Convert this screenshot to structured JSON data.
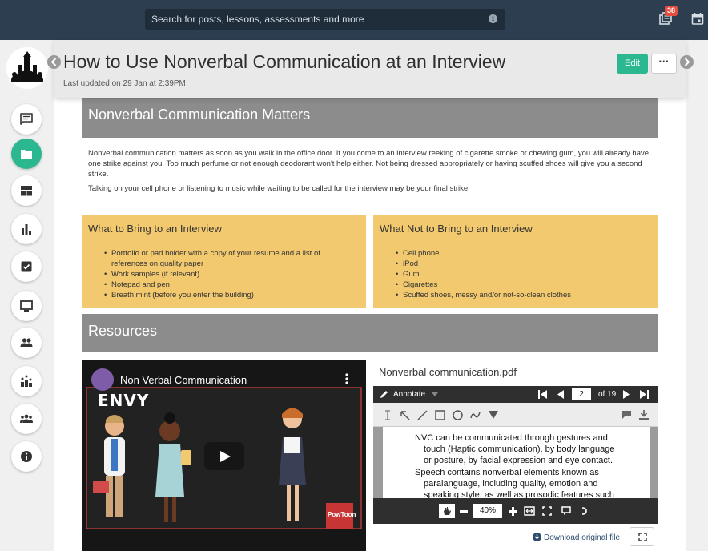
{
  "topbar": {
    "search_placeholder": "Search for posts, lessons, assessments and more",
    "notification_count": "38"
  },
  "header": {
    "title": "How to Use Nonverbal Communication at an Interview",
    "updated": "Last updated on 29 Jan at 2:39PM",
    "edit_label": "Edit",
    "more_label": "···"
  },
  "section1": {
    "title": "Nonverbal Communication Matters",
    "para1": "Nonverbal communication matters as soon as you walk in the office door. If you come to an interview reeking of cigarette smoke or chewing gum, you will already have one strike against you. Too much perfume or not enough deodorant won't help either. Not being dressed appropriately or having scuffed shoes will give you a second strike.",
    "para2": "Talking on your cell phone or listening to music while waiting to be called for the interview may be your final strike."
  },
  "bring": {
    "title": "What to Bring to an Interview",
    "items": [
      "Portfolio or pad holder with a copy of your resume and a list of",
      "references on quality paper",
      "Work samples (if relevant)",
      "Notepad and pen",
      "Breath mint (before you enter the building)"
    ]
  },
  "not_bring": {
    "title": "What Not to Bring to an Interview",
    "items": [
      "Cell phone",
      "iPod",
      "Gum",
      "Cigarettes",
      "Scuffed shoes, messy and/or not-so-clean clothes"
    ]
  },
  "resources": {
    "title": "Resources"
  },
  "video": {
    "title": "Non Verbal Communication",
    "overlay_word": "ENVY",
    "badge": "PowToon"
  },
  "pdf": {
    "filename": "Nonverbal communication.pdf",
    "annotate_label": "Annotate",
    "page_current": "2",
    "page_total": "of 19",
    "zoom": "40%",
    "lines": [
      "NVC can be communicated through gestures and",
      "touch (Haptic communication), by body language",
      "or posture, by facial expression and eye contact.",
      "Speech contains nonverbal elements known as",
      "paralanguage, including quality, emotion and",
      "speaking style, as well as prosodic features such"
    ],
    "download_label": "Download original file"
  },
  "colors": {
    "topbar": "#2c3e50",
    "accent": "#2bb890",
    "band": "#8c8c8c",
    "yellow": "#f2c96e",
    "badge": "#e74c3c"
  },
  "rail_icons": [
    "comments-icon",
    "folder-icon",
    "dashboard-icon",
    "bar-chart-icon",
    "checkbox-icon",
    "monitor-icon",
    "people-icon",
    "ranking-icon",
    "group-icon",
    "info-icon"
  ]
}
